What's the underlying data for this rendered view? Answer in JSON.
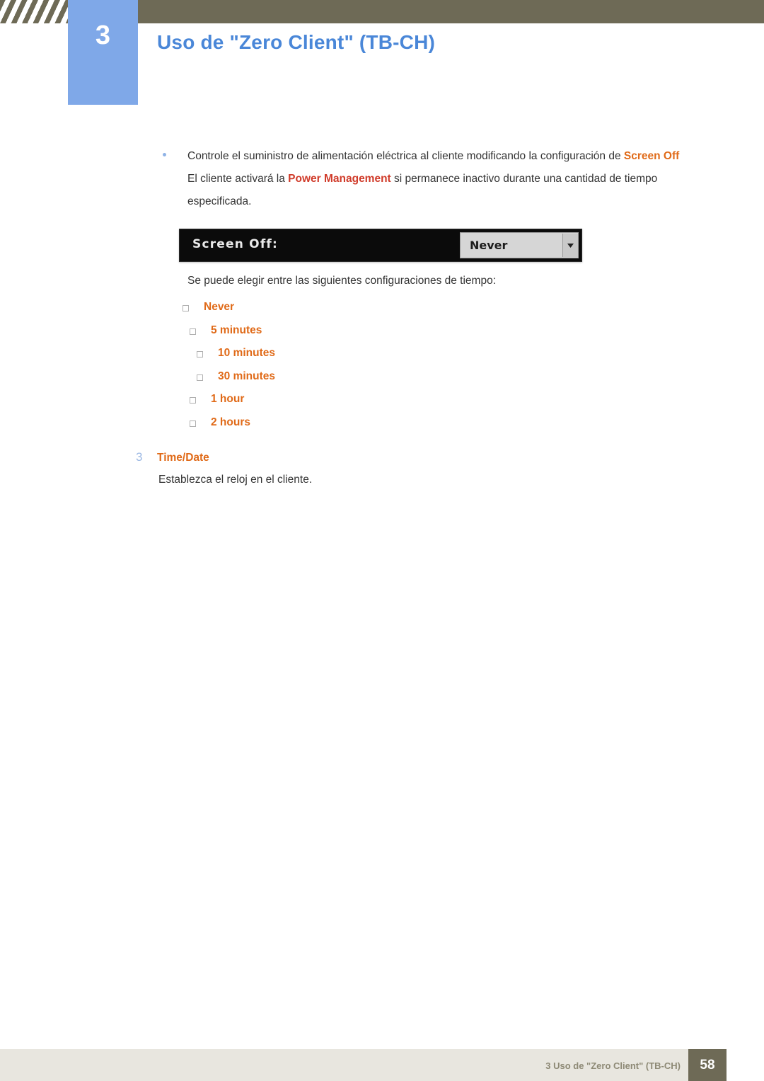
{
  "header": {
    "chapter_number": "3",
    "chapter_title": "Uso de \"Zero Client\" (TB-CH)",
    "accent_color": "#7fa8e8",
    "band_color": "#6e6a56"
  },
  "body": {
    "bullet": {
      "text_part_1": "Controle el suministro de alimentación eléctrica al cliente modificando la configuración de ",
      "keyword_1": "Screen Off",
      "text_part_2": " El cliente activará la ",
      "keyword_2": "Power Management",
      "text_part_3": " si permanece inactivo durante una cantidad de tiempo especificada."
    },
    "osd_figure": {
      "label": "Screen Off:",
      "selected_value": "Never",
      "dropdown_icon": "chevron-down-icon"
    },
    "intro_options": "Se puede elegir entre las siguientes configuraciones de tiempo:",
    "options": [
      {
        "label": "Never",
        "indent": 258
      },
      {
        "label": "5 minutes",
        "indent": 268
      },
      {
        "label": "10 minutes",
        "indent": 278
      },
      {
        "label": "30 minutes",
        "indent": 278
      },
      {
        "label": "1 hour",
        "indent": 268
      },
      {
        "label": "2 hours",
        "indent": 268
      }
    ],
    "sub_section": {
      "number": "3",
      "title": "Time/Date",
      "description": "Establezca el reloj en el cliente."
    }
  },
  "footer": {
    "text": "3 Uso de \"Zero Client\" (TB-CH)",
    "page_number": "58"
  },
  "colors": {
    "orange": "#e06a18",
    "red": "#d03b2a",
    "blue_title": "#4a87d8",
    "footer_gray": "#8d8975"
  }
}
